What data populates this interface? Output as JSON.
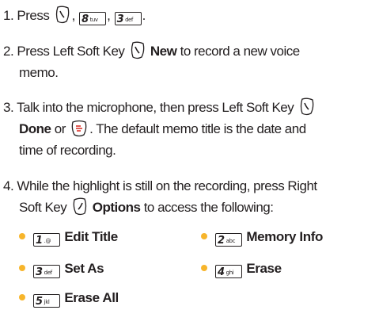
{
  "colors": {
    "text": "#231f20",
    "bullet": "#f7b52b"
  },
  "step1": {
    "num": "1.",
    "press": "Press",
    "comma1": ",",
    "comma2": ",",
    "period": ".",
    "key1_icon": "left-soft-key-icon",
    "key2": {
      "digit": "8",
      "letters": "tuv"
    },
    "key3": {
      "digit": "3",
      "letters": "def"
    }
  },
  "step2": {
    "num": "2.",
    "text_a": "Press Left Soft Key",
    "bold": "New",
    "text_b": "to record a new voice",
    "text_c": "memo."
  },
  "step3": {
    "num": "3.",
    "text_a": "Talk into the microphone, then press Left Soft Key",
    "bold": "Done",
    "or": "or",
    "text_b": ". The default memo title is the date and",
    "text_c": "time of recording."
  },
  "step4": {
    "num": "4.",
    "text_a": "While the highlight is still on the recording, press Right",
    "text_b": "Soft Key",
    "bold": "Options",
    "text_c": "to access the following:"
  },
  "options": [
    {
      "digit": "1",
      "letters": ".@",
      "label": "Edit Title"
    },
    {
      "digit": "2",
      "letters": "abc",
      "label": "Memory Info"
    },
    {
      "digit": "3",
      "letters": "def",
      "label": "Set As"
    },
    {
      "digit": "4",
      "letters": "ghi",
      "label": "Erase"
    },
    {
      "digit": "5",
      "letters": "jkl",
      "label": "Erase All"
    }
  ]
}
